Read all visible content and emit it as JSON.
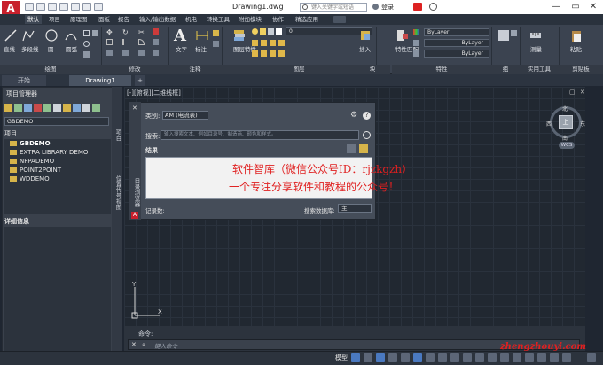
{
  "titlebar": {
    "logo": "A",
    "doc_title": "Drawing1.dwg",
    "search_placeholder": "键入关键字或短语",
    "login": "登录"
  },
  "ribbon_tabs": [
    "默认",
    "插入",
    "注释",
    "参数化",
    "视图",
    "管理",
    "输出",
    "附加模块",
    "A360",
    "精选应用",
    "Performance"
  ],
  "ribbon_tabs_shown": [
    "默认",
    "项目",
    "原理图",
    "面板",
    "报告",
    "输入/输出数据",
    "机电",
    "转换工具",
    "附加模块",
    "协作",
    "精选应用"
  ],
  "ribbon": {
    "draw_tools": [
      "直线",
      "多段线",
      "圆",
      "圆弧"
    ],
    "draw_panel": "绘图",
    "modify_panel": "修改",
    "annotation_tools": [
      "文字",
      "标注"
    ],
    "annotation_panel": "注释",
    "layer_tools": [
      "图层特性"
    ],
    "layer_combo": "0",
    "layer_panel": "图层",
    "block_tools": [
      "插入"
    ],
    "block_panel": "块",
    "props_tools": [
      "特性匹配"
    ],
    "prop_combos": [
      "ByLayer",
      "ByLayer",
      "ByLayer"
    ],
    "props_panel": "特性",
    "group_panel": "组",
    "util_tools": [
      "测量"
    ],
    "util_panel": "实用工具",
    "clip_tools": [
      "粘贴"
    ],
    "clip_panel": "剪贴板"
  },
  "doc_tabs": {
    "start": "开始",
    "drawing": "Drawing1"
  },
  "palette": {
    "title": "项目管理器",
    "project_select": "GBDEMO",
    "section": "项目",
    "tree": [
      "GBDEMO",
      "EXTRA LIBRARY DEMO",
      "NFPADEMO",
      "POINT2POINT",
      "WDDEMO"
    ],
    "details": "详细信息",
    "side_tabs": [
      "项目",
      "位置代号视图"
    ]
  },
  "viewport_label": "[-][俯视][二维线框]",
  "dialog": {
    "category_label": "类别:",
    "category_value": "AM (电流表)",
    "search_label": "搜索:",
    "search_placeholder": "输入搜索文本、例如目录号、制造商、颜色和样式。",
    "results_label": "结果",
    "records_label": "记录数:",
    "db_label": "搜索数据库:",
    "db_value": "主",
    "side_text": "目录浏览器"
  },
  "watermark": {
    "line1": "软件智库（微信公众号ID：rjzkgzh）",
    "line2": "一个专注分享软件和教程的公众号！"
  },
  "viewcube": {
    "north": "北",
    "south": "南",
    "west": "西",
    "east": "东",
    "top": "上",
    "wcs": "WCS"
  },
  "command": {
    "history_label": "命令:",
    "prompt": "键入命令"
  },
  "status": {
    "model": "模型",
    "url_watermark": "zhengzhouyi.com"
  },
  "colors": {
    "accent": "#c8202c",
    "canvas": "#212831",
    "dialog": "#454d59",
    "watermark": "#e02020"
  }
}
